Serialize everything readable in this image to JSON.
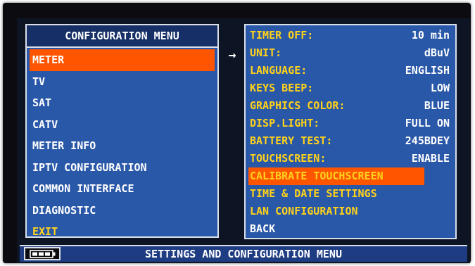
{
  "config_menu": {
    "title": "CONFIGURATION MENU",
    "items": [
      {
        "label": "METER",
        "selected": true
      },
      {
        "label": "TV"
      },
      {
        "label": "SAT"
      },
      {
        "label": "CATV"
      },
      {
        "label": "METER INFO"
      },
      {
        "label": "IPTV CONFIGURATION"
      },
      {
        "label": "COMMON INTERFACE"
      },
      {
        "label": "DIAGNOSTIC"
      },
      {
        "label": "EXIT"
      }
    ]
  },
  "arrow": "→",
  "meter_settings": {
    "rows": [
      {
        "label": "TIMER OFF:",
        "value": "10 min"
      },
      {
        "label": "UNIT:",
        "value": "dBuV"
      },
      {
        "label": "LANGUAGE:",
        "value": "ENGLISH"
      },
      {
        "label": "KEYS BEEP:",
        "value": "LOW"
      },
      {
        "label": "GRAPHICS COLOR:",
        "value": "BLUE"
      },
      {
        "label": "DISP.LIGHT:",
        "value": "FULL ON"
      },
      {
        "label": "BATTERY TEST:",
        "value": "245BDEY"
      },
      {
        "label": "TOUCHSCREEN:",
        "value": "ENABLE"
      }
    ],
    "actions": [
      {
        "label": "CALIBRATE TOUCHSCREEN",
        "highlighted": true
      },
      {
        "label": "TIME & DATE SETTINGS"
      },
      {
        "label": "LAN CONFIGURATION"
      },
      {
        "label": "BACK"
      }
    ]
  },
  "status_bar": {
    "text": "SETTINGS AND CONFIGURATION MENU",
    "battery_icon": "battery-icon"
  },
  "colors": {
    "panel": "#2a58a8",
    "selection": "#ff5500",
    "label_yellow": "#ffd21a",
    "text_white": "#ffffff"
  }
}
